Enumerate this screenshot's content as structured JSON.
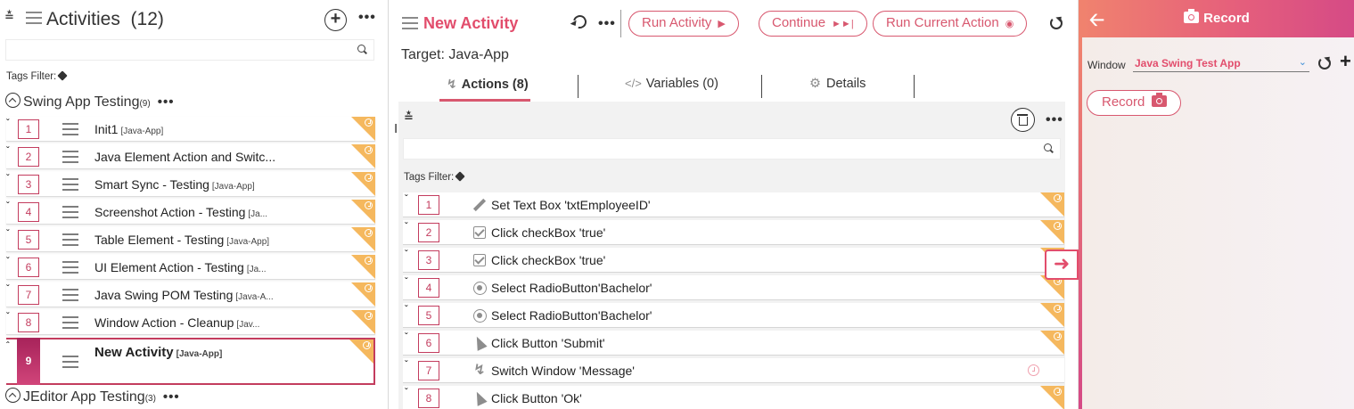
{
  "activities_panel": {
    "title": "Activities",
    "count": "(12)",
    "tags_filter_label": "Tags Filter:",
    "search_placeholder": "",
    "groups": [
      {
        "name": "Swing App Testing",
        "count": "(9)"
      },
      {
        "name": "JEditor App Testing",
        "count": "(3)"
      }
    ],
    "activities": [
      {
        "num": "1",
        "name": "Init1",
        "tag": "[Java-App]"
      },
      {
        "num": "2",
        "name": "Java Element Action and Switc...",
        "tag": ""
      },
      {
        "num": "3",
        "name": "Smart Sync - Testing",
        "tag": "[Java-App]"
      },
      {
        "num": "4",
        "name": "Screenshot Action - Testing",
        "tag": "[Ja..."
      },
      {
        "num": "5",
        "name": "Table Element - Testing",
        "tag": "[Java-App]"
      },
      {
        "num": "6",
        "name": "UI Element Action - Testing",
        "tag": "[Ja..."
      },
      {
        "num": "7",
        "name": "Java Swing POM Testing",
        "tag": "[Java-A..."
      },
      {
        "num": "8",
        "name": "Window Action - Cleanup",
        "tag": "[Jav..."
      },
      {
        "num": "9",
        "name": "New Activity",
        "tag": "[Java-App]",
        "selected": true
      }
    ]
  },
  "activity_editor": {
    "title": "New Activity",
    "target": "Target: Java-App",
    "buttons": {
      "run_activity": "Run Activity",
      "continue": "Continue",
      "run_current_action": "Run Current Action"
    },
    "tabs": [
      {
        "label": "Actions (8)",
        "icon": "bolt-icon",
        "active": true
      },
      {
        "label": "Variables (0)",
        "icon": "code-icon",
        "active": false
      },
      {
        "label": "Details",
        "icon": "gear-icon",
        "active": false
      }
    ],
    "tags_filter_label": "Tags Filter:",
    "actions": [
      {
        "num": "1",
        "icon": "pencil-icon",
        "name": "Set Text Box 'txtEmployeeID'"
      },
      {
        "num": "2",
        "icon": "checkbox-icon",
        "name": "Click checkBox 'true'"
      },
      {
        "num": "3",
        "icon": "checkbox-icon",
        "name": "Click checkBox 'true'"
      },
      {
        "num": "4",
        "icon": "radio-icon",
        "name": "Select RadioButton'Bachelor'"
      },
      {
        "num": "5",
        "icon": "radio-icon",
        "name": "Select RadioButton'Bachelor'"
      },
      {
        "num": "6",
        "icon": "cursor-icon",
        "name": "Click Button 'Submit'"
      },
      {
        "num": "7",
        "icon": "bolt-icon",
        "name": "Switch Window 'Message'"
      },
      {
        "num": "8",
        "icon": "cursor-icon",
        "name": "Click Button 'Ok'"
      }
    ]
  },
  "record_panel": {
    "title": "Record",
    "window_label": "Window",
    "window_value": "Java Swing Test App",
    "record_button": "Record"
  },
  "colors": {
    "accent": "#e24d6c",
    "accent_border": "#d8586f",
    "corner_flag": "#f5b85e",
    "header_gradient_start": "#f0836e",
    "header_gradient_end": "#d54a86"
  }
}
